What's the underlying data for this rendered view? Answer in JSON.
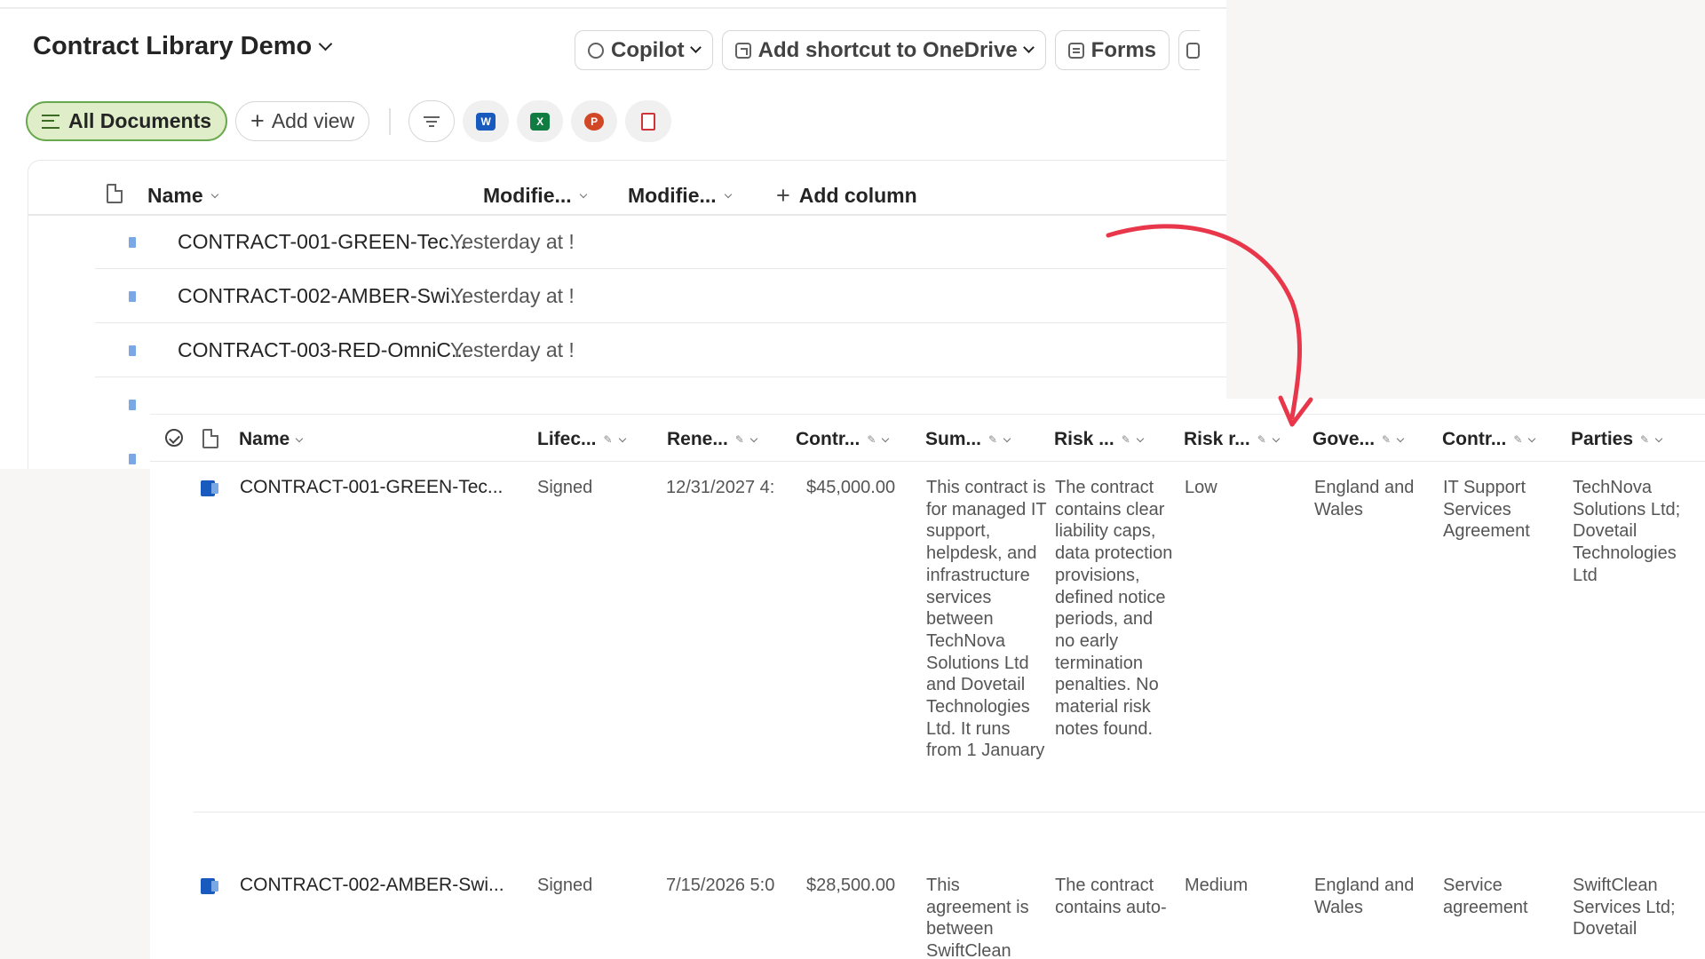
{
  "library": {
    "title": "Contract Library Demo",
    "commands": [
      {
        "label": "Copilot",
        "icon": "copilot-icon"
      },
      {
        "label": "Add shortcut to OneDrive",
        "icon": "shortcut-icon"
      },
      {
        "label": "Forms",
        "icon": "forms-icon"
      }
    ],
    "views": {
      "active": "All Documents",
      "add_view": "Add view"
    },
    "quick_icons": [
      "filter-icon",
      "word-icon",
      "excel-icon",
      "powerpoint-icon",
      "pdf-icon"
    ],
    "columns": {
      "name": "Name",
      "modified": "Modifie...",
      "modified_by": "Modifie...",
      "add_column": "Add column"
    },
    "rows": [
      {
        "name": "CONTRACT-001-GREEN-Tec...",
        "modified": "Yesterday at !"
      },
      {
        "name": "CONTRACT-002-AMBER-Swi...",
        "modified": "Yesterday at !"
      },
      {
        "name": "CONTRACT-003-RED-OmniC...",
        "modified": "Yesterday at !"
      }
    ]
  },
  "detail": {
    "columns": {
      "name": "Name",
      "lifecycle": "Lifec...",
      "renewal": "Rene...",
      "contract_value": "Contr...",
      "summary": "Sum...",
      "risk_notes": "Risk ...",
      "risk_rating": "Risk r...",
      "governing_law": "Gove...",
      "contract_type": "Contr...",
      "parties": "Parties"
    },
    "rows": [
      {
        "name": "CONTRACT-001-GREEN-Tec...",
        "lifecycle": "Signed",
        "renewal": "12/31/2027 4:",
        "value": "$45,000.00",
        "summary": "This contract is for managed IT support, helpdesk, and infrastructure services between TechNova Solutions Ltd and Dovetail Technologies Ltd. It runs from 1 January",
        "risk_notes": "The contract contains clear liability caps, data protection provisions, defined notice periods, and no early termination penalties. No material risk notes found.",
        "risk_rating": "Low",
        "governing_law": "England and Wales",
        "contract_type": "IT Support Services Agreement",
        "parties": "TechNova Solutions Ltd; Dovetail Technologies Ltd"
      },
      {
        "name": "CONTRACT-002-AMBER-Swi...",
        "lifecycle": "Signed",
        "renewal": "7/15/2026 5:0",
        "value": "$28,500.00",
        "summary": "This agreement is between SwiftClean",
        "risk_notes": "The contract contains auto-",
        "risk_rating": "Medium",
        "governing_law": "England and Wales",
        "contract_type": "Service agreement",
        "parties": "SwiftClean Services Ltd; Dovetail"
      }
    ]
  },
  "colors": {
    "accent_green": "#6aa84f",
    "active_view_bg": "#dfeec8",
    "arrow": "#e8374a",
    "word_blue": "#185abd",
    "excel_green": "#107c41",
    "ppt_red": "#d24726",
    "pdf_red": "#d13438"
  }
}
